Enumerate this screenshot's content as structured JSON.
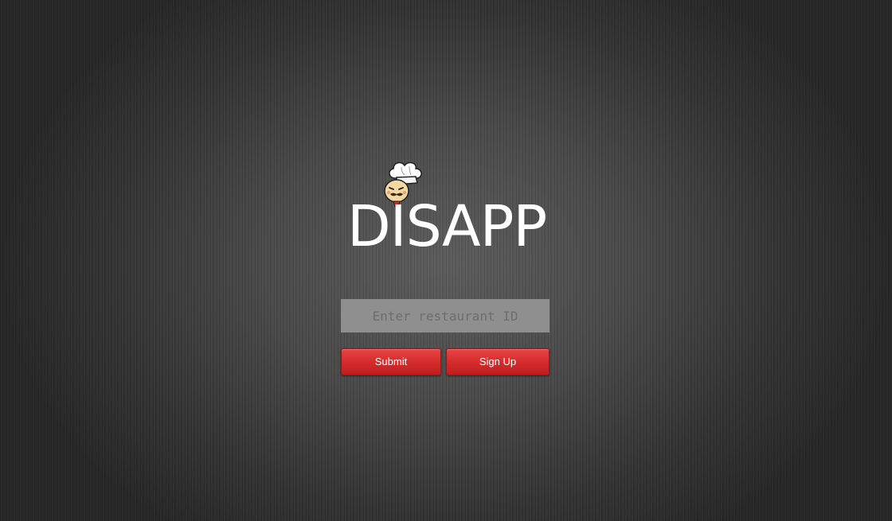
{
  "app": {
    "logo_text": "DISAPP",
    "logo_icon": "chef-mascot-icon"
  },
  "login": {
    "restaurant_id_placeholder": "Enter restaurant ID",
    "restaurant_id_value": "",
    "submit_label": "Submit",
    "signup_label": "Sign Up"
  },
  "colors": {
    "background": "#4a4a4a",
    "button_red": "#d62c2c",
    "input_bg": "#8f8f8f",
    "logo_text": "#ffffff"
  }
}
